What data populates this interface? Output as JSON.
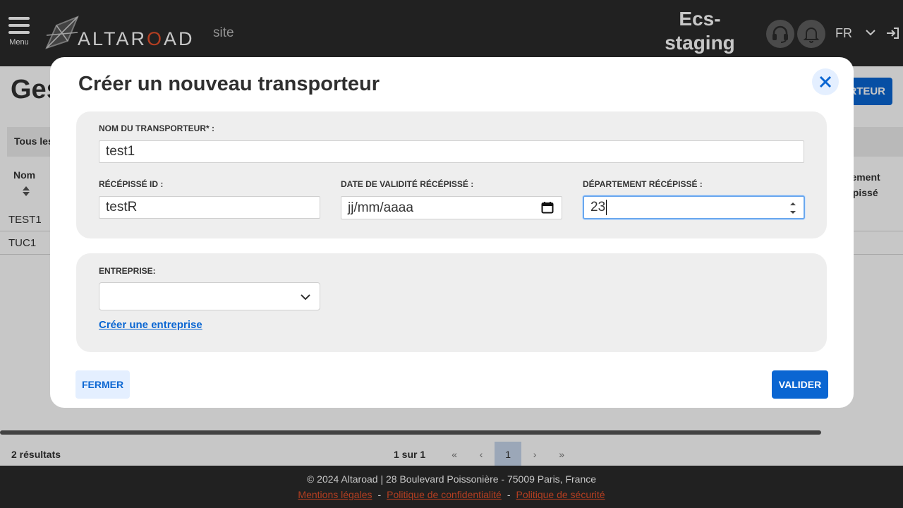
{
  "header": {
    "menu_label": "Menu",
    "brand_name_part1": "ALTAR",
    "brand_name_o": "O",
    "brand_name_part2": "AD",
    "site_label": "site",
    "environment": "Ecs-staging",
    "language": "FR",
    "icons": [
      "menu-icon",
      "headset-icon",
      "bell-icon",
      "chevron-down-icon",
      "logout-icon"
    ]
  },
  "page": {
    "title": "Ges",
    "add_button_label": "RTEUR",
    "tab_all": "Tous les",
    "columns": {
      "name": "Nom",
      "department": "partement récépissé"
    },
    "rows": [
      {
        "name": "TEST1"
      },
      {
        "name": "TUC1"
      }
    ],
    "results": "2 résultats",
    "pagination": {
      "info": "1 sur 1",
      "first": "«",
      "prev": "‹",
      "current": "1",
      "next": "›",
      "last": "»"
    }
  },
  "modal": {
    "title": "Créer un nouveau transporteur",
    "fields": {
      "carrier_name": {
        "label": "NOM DU TRANSPORTEUR* :",
        "value": "test1"
      },
      "receipt_id": {
        "label": "RÉCÉPISSÉ ID :",
        "value": "testR"
      },
      "receipt_validity": {
        "label": "DATE DE VALIDITÉ RÉCÉPISSÉ :",
        "placeholder": "jj/mm/aaaa"
      },
      "receipt_department": {
        "label": "DÉPARTEMENT RÉCÉPISSÉ :",
        "value": "23"
      },
      "company": {
        "label": "ENTREPRISE:",
        "value": ""
      }
    },
    "create_company_link": "Créer une entreprise",
    "close_button": "FERMER",
    "submit_button": "VALIDER"
  },
  "footer": {
    "address": "© 2024 Altaroad | 28 Boulevard Poissonière - 75009 Paris, France",
    "links": [
      "Mentions légales",
      "Politique de confidentialité",
      "Politique de sécurité"
    ],
    "separator": "-"
  },
  "colors": {
    "header_bg": "#2b2b2b",
    "primary": "#0a66d2",
    "accent_orange": "#e8502b",
    "section_bg": "#eeeeee"
  }
}
